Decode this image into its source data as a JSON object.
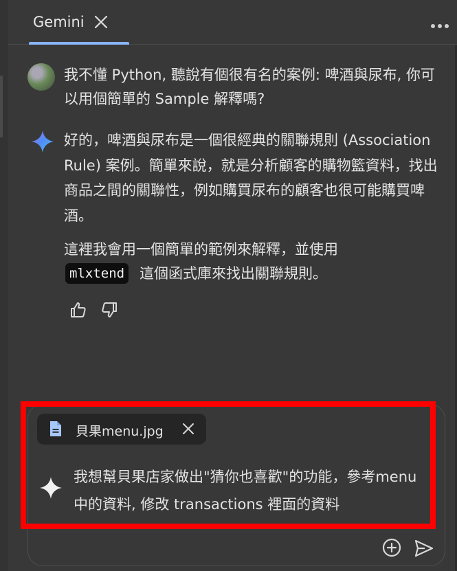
{
  "tab": {
    "label": "Gemini"
  },
  "conversation": {
    "user_message": "我不懂 Python, 聽說有個很有名的案例: 啤酒與尿布, 你可以用個簡單的 Sample 解釋嗎?",
    "reply_paragraph_1": "好的，啤酒與尿布是一個很經典的關聯規則 (Association Rule) 案例。簡單來說，就是分析顧客的購物籃資料，找出商品之間的關聯性，例如購買尿布的顧客也很可能購買啤酒。",
    "reply_paragraph_2_before": "這裡我會用一個簡單的範例來解釋，並使用",
    "reply_code": "mlxtend",
    "reply_paragraph_2_after": "這個函式庫來找出關聯規則。"
  },
  "input": {
    "attachment_name": "貝果menu.jpg",
    "prompt_text": "我想幫貝果店家做出\"猜你也喜歡\"的功能，參考menu中的資料, 修改 transactions 裡面的資料"
  },
  "colors": {
    "background": "#383838",
    "accent": "#8ab4f8",
    "highlight": "#ff0000"
  },
  "icons": {
    "tab_close": "close-icon",
    "more": "more-icon",
    "gemini": "gemini-sparkle-icon",
    "thumb_up": "thumb-up-icon",
    "thumb_down": "thumb-down-icon",
    "file": "file-icon",
    "attachment_remove": "close-icon",
    "prompt_sparkle": "sparkle-icon",
    "add": "add-circle-icon",
    "send": "send-icon"
  }
}
